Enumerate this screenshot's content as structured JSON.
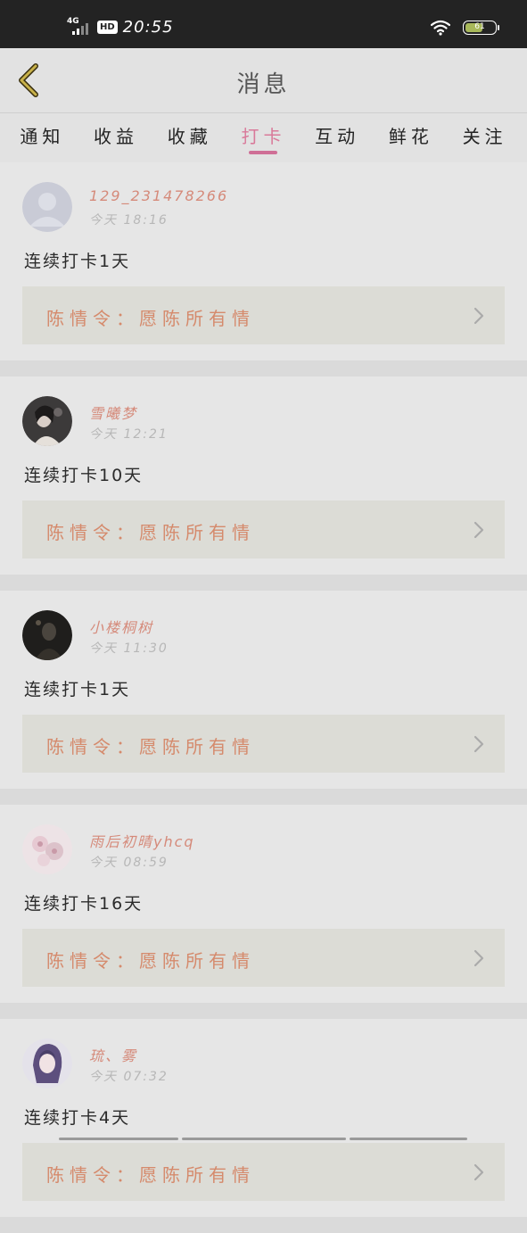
{
  "status_bar": {
    "network": "4G",
    "hd": "HD",
    "time": "20:55",
    "battery": "61",
    "battery_level_pct": 61
  },
  "header": {
    "title": "消息",
    "back_icon": "chevron-left-icon"
  },
  "tabs": [
    {
      "label": "通知",
      "active": false
    },
    {
      "label": "收益",
      "active": false
    },
    {
      "label": "收藏",
      "active": false
    },
    {
      "label": "打卡",
      "active": true
    },
    {
      "label": "互动",
      "active": false
    },
    {
      "label": "鲜花",
      "active": false
    },
    {
      "label": "关注",
      "active": false
    }
  ],
  "cards": [
    {
      "username": "129_231478266",
      "time": "今天 18:16",
      "text": "连续打卡1天",
      "work": "陈情令：愿陈所有情",
      "avatar": "default-avatar"
    },
    {
      "username": "雪曦梦",
      "time": "今天 12:21",
      "text": "连续打卡10天",
      "work": "陈情令：愿陈所有情",
      "avatar": "photo-avatar"
    },
    {
      "username": "小楼桐树",
      "time": "今天 11:30",
      "text": "连续打卡1天",
      "work": "陈情令：愿陈所有情",
      "avatar": "dark-photo-avatar"
    },
    {
      "username": "雨后初晴yhcq",
      "time": "今天 08:59",
      "text": "连续打卡16天",
      "work": "陈情令：愿陈所有情",
      "avatar": "floral-avatar"
    },
    {
      "username": "琉、雾",
      "time": "今天 07:32",
      "text": "连续打卡4天",
      "work": "陈情令：愿陈所有情",
      "avatar": "anime-avatar"
    }
  ],
  "colors": {
    "accent": "#cf6f96",
    "name": "#d58a7a",
    "work_title": "#d58a6c"
  }
}
